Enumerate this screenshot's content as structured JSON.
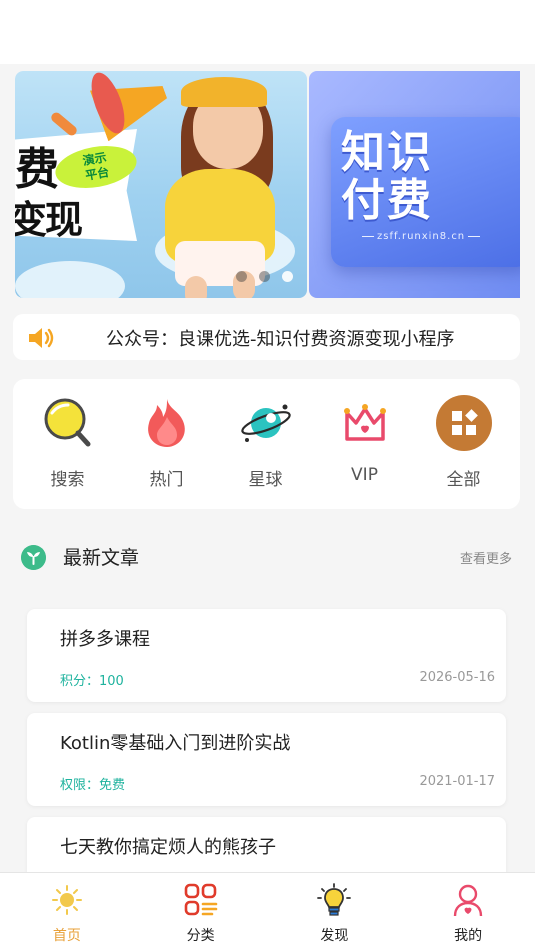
{
  "banner": {
    "slide1": {
      "title_line1": "费",
      "title_line2": "变现",
      "tag_line1": "演示",
      "tag_line2": "平台"
    },
    "slide2": {
      "title_line1": "知识",
      "title_line2": "付费",
      "url": "zsff.runxin8.cn"
    },
    "dots": 3,
    "active_dot": 2
  },
  "notice": {
    "text": "公众号：良课优选-知识付费资源变现小程序",
    "icon": "speaker-icon"
  },
  "quicknav": [
    {
      "label": "搜索",
      "icon": "search-icon"
    },
    {
      "label": "热门",
      "icon": "fire-icon"
    },
    {
      "label": "星球",
      "icon": "planet-icon"
    },
    {
      "label": "VIP",
      "icon": "crown-icon"
    },
    {
      "label": "全部",
      "icon": "grid-icon"
    }
  ],
  "section": {
    "title": "最新文章",
    "more": "查看更多",
    "icon": "sprout-icon"
  },
  "articles": [
    {
      "title": "拼多多课程",
      "meta": "积分：100",
      "date": "2026-05-16"
    },
    {
      "title": "Kotlin零基础入门到进阶实战",
      "meta": "权限：免费",
      "date": "2021-01-17"
    },
    {
      "title": "七天教你搞定烦人的熊孩子",
      "meta": "",
      "date": ""
    }
  ],
  "tabbar": [
    {
      "label": "首页",
      "icon": "home-sun-icon",
      "active": true
    },
    {
      "label": "分类",
      "icon": "category-icon",
      "active": false
    },
    {
      "label": "发现",
      "icon": "lightbulb-icon",
      "active": false
    },
    {
      "label": "我的",
      "icon": "user-icon",
      "active": false
    }
  ],
  "colors": {
    "accent": "#e8a13a",
    "green": "#1fb39e",
    "vip": "#e94a6b",
    "fire": "#f25a5a"
  }
}
